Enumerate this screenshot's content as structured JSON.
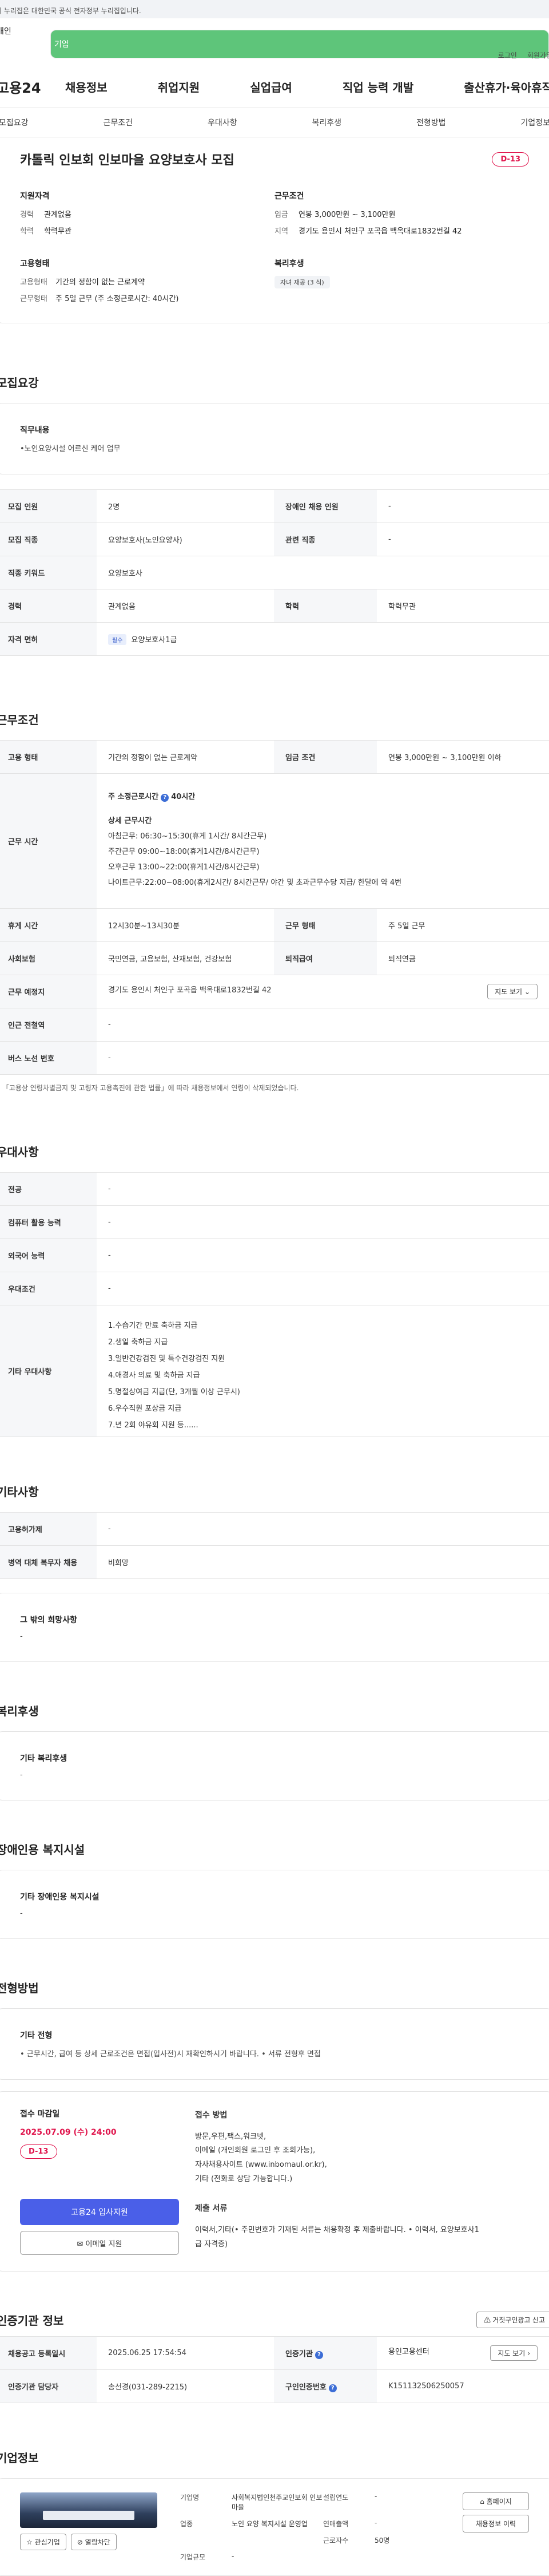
{
  "gov_banner": "이 누리집은 대한민국 공식 전자정부 누리집입니다.",
  "user_tabs": {
    "personal": "개인",
    "company": "기업"
  },
  "util_links": [
    "로그인",
    "회원가입"
  ],
  "logo": "고용24",
  "gnb": [
    "채용정보",
    "취업지원",
    "실업급여",
    "직업 능력 개발",
    "출산휴가·육아휴직"
  ],
  "tab_nav": [
    "모집요강",
    "근무조건",
    "우대사항",
    "복리후생",
    "전형방법",
    "기업정보"
  ],
  "summary": {
    "title": "카톨릭 인보회 인보마을 요양보호사 모집",
    "dday": "D-13",
    "qual_title": "지원자격",
    "qual": [
      {
        "k": "경력",
        "v": "관계없음"
      },
      {
        "k": "학력",
        "v": "학력무관"
      }
    ],
    "cond_title": "근무조건",
    "cond": [
      {
        "k": "임금",
        "v": "연봉 3,000만원 ~ 3,100만원"
      },
      {
        "k": "지역",
        "v": "경기도 용인시 처인구 포곡읍 백옥대로1832번길 42"
      }
    ],
    "emp_title": "고용형태",
    "emp": [
      {
        "k": "고용형태",
        "v": "기간의 정함이 없는 근로계약"
      },
      {
        "k": "근무형태",
        "v": "주 5일 근무 (주 소정근로시간: 40시간)"
      }
    ],
    "welfare_title": "복리후생",
    "welfare_chip": "자녀 재공 (3 식)"
  },
  "recruit": {
    "section_title": "모집요강",
    "duty_title": "직무내용",
    "duty_text": "•노인요양시설 어르신 케어 업무",
    "rows": [
      {
        "k1": "모집 인원",
        "v1": "2명",
        "k2": "장애인 채용 인원",
        "v2": "-"
      },
      {
        "k1": "모집 직종",
        "v1": "요양보호사(노인요양사)",
        "k2": "관련 직종",
        "v2": "-"
      },
      {
        "k1": "직종 키워드",
        "v1": "요양보호사"
      },
      {
        "k1": "경력",
        "v1": "관계없음",
        "k2": "학력",
        "v2": "학력무관"
      }
    ],
    "license_label": "자격 면허",
    "license_tag": "필수",
    "license_value": "요양보호사1급"
  },
  "work": {
    "section_title": "근무조건",
    "emp_type_label": "고용 형태",
    "emp_type_value": "기간의 정함이 없는 근로계약",
    "wage_label": "임금 조건",
    "wage_value": "연봉 3,000만원 ~ 3,100만원 이하",
    "time_label": "근무 시간",
    "time_main": "주 소정근로시간",
    "time_hours": "40시간",
    "time_detail_title": "상세 근무시간",
    "time_lines": [
      "아침근무: 06:30~15:30(휴게 1시간/ 8시간근무)",
      "주간근무 09:00~18:00(휴게1시간/8시간근무)",
      "오후근무 13:00~22:00(휴게1시간/8시간근무)",
      "나이트근무:22:00~08:00(휴게2시간/ 8시간근무/ 야간 및 초과근무수당 지급/ 한달에 약 4번"
    ],
    "rest_label": "휴게 시간",
    "rest_value": "12시30분~13시30분",
    "form_label": "근무 형태",
    "form_value": "주 5일 근무",
    "insurance_label": "사회보험",
    "insurance_value": "국민연금, 고용보험, 산재보험, 건강보험",
    "retire_label": "퇴직급여",
    "retire_value": "퇴직연금",
    "place_label": "근무 예정지",
    "place_value": "경기도 용인시 처인구 포곡읍 백옥대로1832번길 42",
    "map_btn": "지도 보기",
    "subway_label": "인근 전철역",
    "subway_value": "-",
    "bus_label": "버스 노선 번호",
    "bus_value": "-",
    "note": "* 「고용상 연령차별금지 및 고령자 고용촉진에 관한 법률」에 따라 채용정보에서 연령이 삭제되었습니다."
  },
  "prefer": {
    "section_title": "우대사항",
    "rows": [
      {
        "k": "전공",
        "v": "-"
      },
      {
        "k": "컴퓨터 활용 능력",
        "v": "-"
      },
      {
        "k": "외국어 능력",
        "v": "-"
      },
      {
        "k": "우대조건",
        "v": "-"
      }
    ],
    "etc_label": "기타 우대사항",
    "etc_lines": [
      "1.수습기간 만료 축하금 지급",
      "2.생일 축하금 지급",
      "3.일반건강검진 및 특수건강검진 지원",
      "4.애경사 의료 및 축하금 지급",
      "5.명절상여금 지급(단, 3개월 이상 근무시)",
      "6.우수직원 포상금 지급",
      "7.년 2회 야유회 지원    등......"
    ]
  },
  "other": {
    "section_title": "기타사항",
    "rows": [
      {
        "k": "고용허가제",
        "v": "-"
      },
      {
        "k": "병역 대체 복무자 채용",
        "v": "비희망"
      }
    ],
    "wish_title": "그 밖의 희망사항",
    "wish_value": "-"
  },
  "welfare": {
    "section_title": "복리후생",
    "box_title": "기타 복리후생",
    "box_value": "-"
  },
  "facility": {
    "section_title": "장애인용 복지시설",
    "box_title": "기타 장애인용 복지시설",
    "box_value": "-"
  },
  "process": {
    "section_title": "전형방법",
    "box_title": "기타 전형",
    "box_value": "• 근무시간, 급여 등 상세 근로조건은 면접(입사전)시 재확인하시기 바랍니다. • 서류 전형후 면접",
    "deadline_title": "접수 마감일",
    "deadline": "2025.07.09 (수) 24:00",
    "dday": "D-13",
    "apply_btn": "고용24 입사지원",
    "email_btn": "이메일 지원",
    "method_title": "접수 방법",
    "method_lines": [
      "방문,우편,팩스,워크넷,",
      "이메일 (개인회원 로그인 후 조회가능),",
      "자사채용사이트 (www.inbomaul.or.kr),",
      "기타 (전화로 상담 가능합니다.)"
    ],
    "docs_title": "제출 서류",
    "docs_lines": [
      "이력서,기타(• 주민번호가 기재된 서류는 채용확정 후 제출바랍니다. • 이력서, 요양보호사1",
      "급 자격증)"
    ]
  },
  "agency": {
    "section_title": "인증기관 정보",
    "report_btn": "거짓구인광고 신고",
    "rows": [
      {
        "k1": "채용공고 등록일시",
        "v1": "2025.06.25 17:54:54",
        "k2": "인증기관",
        "v2": "용인고용센터",
        "btn": "지도 보기"
      },
      {
        "k1": "인증기관 담당자",
        "v1": "송선경(031-289-2215)",
        "k2": "구인인증번호",
        "v2": "K151132506250057"
      }
    ]
  },
  "company": {
    "section_title": "기업정보",
    "fav_btn": "관심기업",
    "block_btn": "열람차단",
    "fields": [
      {
        "k": "기업명",
        "v": "사회복지법인천주교인보회 인보마을",
        "k2": "설립연도",
        "v2": "-"
      },
      {
        "k": "업종",
        "v": "노인 요양 복지시설 운영업",
        "k2": "연매출액",
        "v2": "-"
      },
      {
        "k": "",
        "v": "",
        "k2": "근로자수",
        "v2": "50명"
      },
      {
        "k": "기업규모",
        "v": "-",
        "k2": "",
        "v2": ""
      }
    ],
    "homepage_btn": "홈페이지",
    "jobs_btn": "채용정보 이력"
  }
}
